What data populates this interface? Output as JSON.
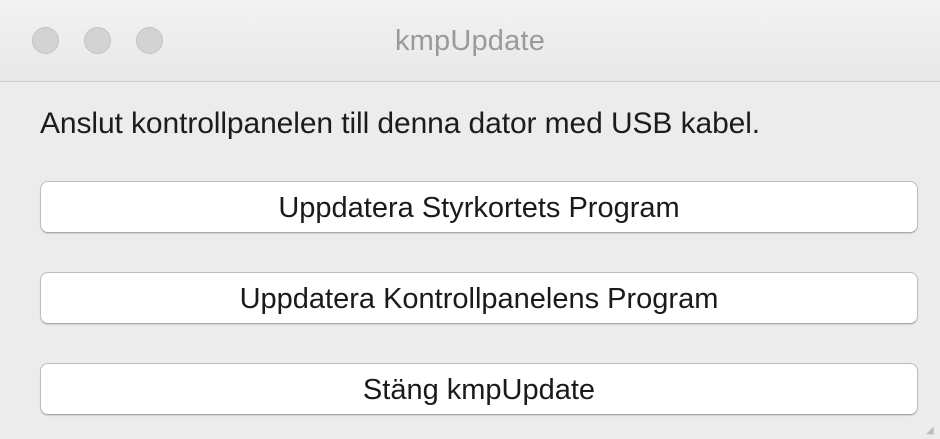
{
  "window": {
    "title": "kmpUpdate",
    "controls": [
      "close",
      "minimize",
      "zoom"
    ]
  },
  "content": {
    "instruction": "Anslut kontrollpanelen till denna dator med USB kabel.",
    "buttons": [
      {
        "label": "Uppdatera Styrkortets Program"
      },
      {
        "label": "Uppdatera Kontrollpanelens Program"
      },
      {
        "label": "Stäng kmpUpdate"
      }
    ]
  },
  "colors": {
    "window_bg": "#ececec",
    "button_bg": "#ffffff",
    "traffic_light_inactive": "#d3d3d3",
    "title_text": "#9a9a9a"
  }
}
